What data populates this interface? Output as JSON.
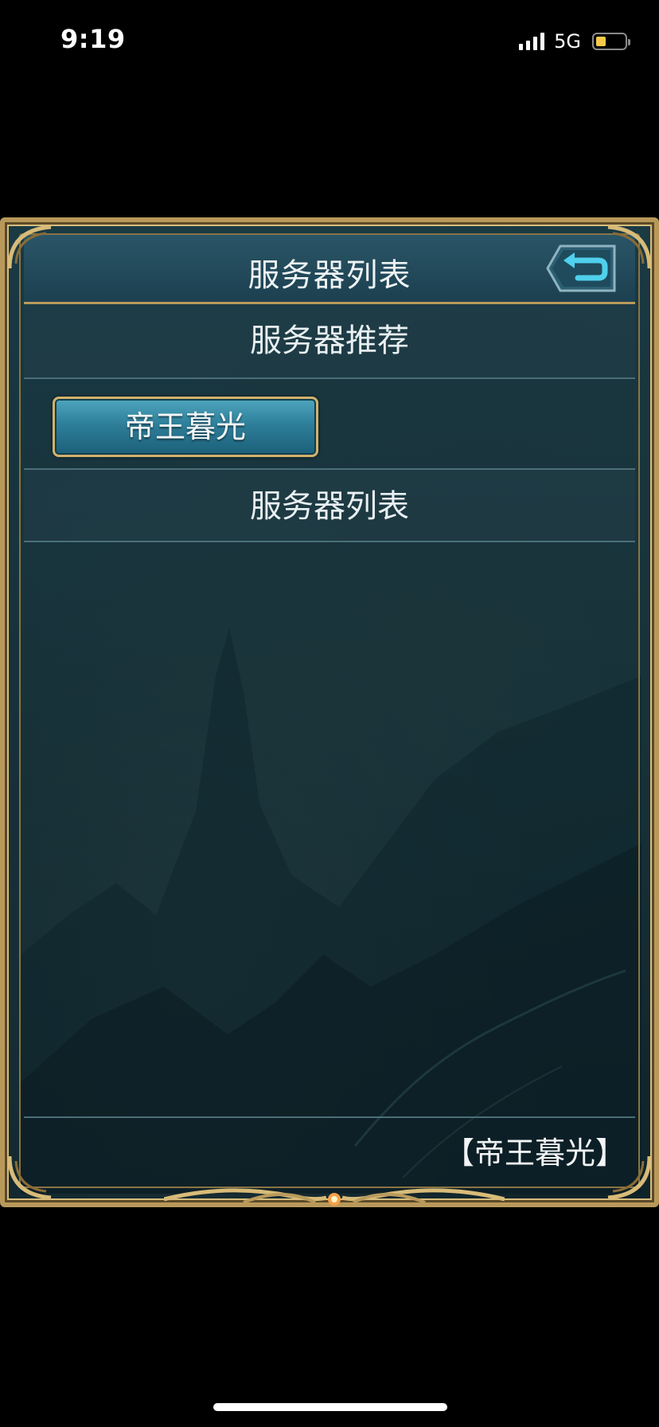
{
  "status_bar": {
    "time": "9:19",
    "network": "5G",
    "battery_level": 0.35
  },
  "header": {
    "title": "服务器列表",
    "back_icon": "return-arrow-icon"
  },
  "sections": {
    "recommend_label": "服务器推荐",
    "recommended_server": "帝王暮光",
    "list_label": "服务器列表"
  },
  "footer": {
    "current_server": "【帝王暮光】"
  },
  "colors": {
    "frame_gold": "#b9995a",
    "panel_teal": "#17323b",
    "button_blue": "#2e7f9a",
    "back_arrow": "#4fd0ec"
  }
}
